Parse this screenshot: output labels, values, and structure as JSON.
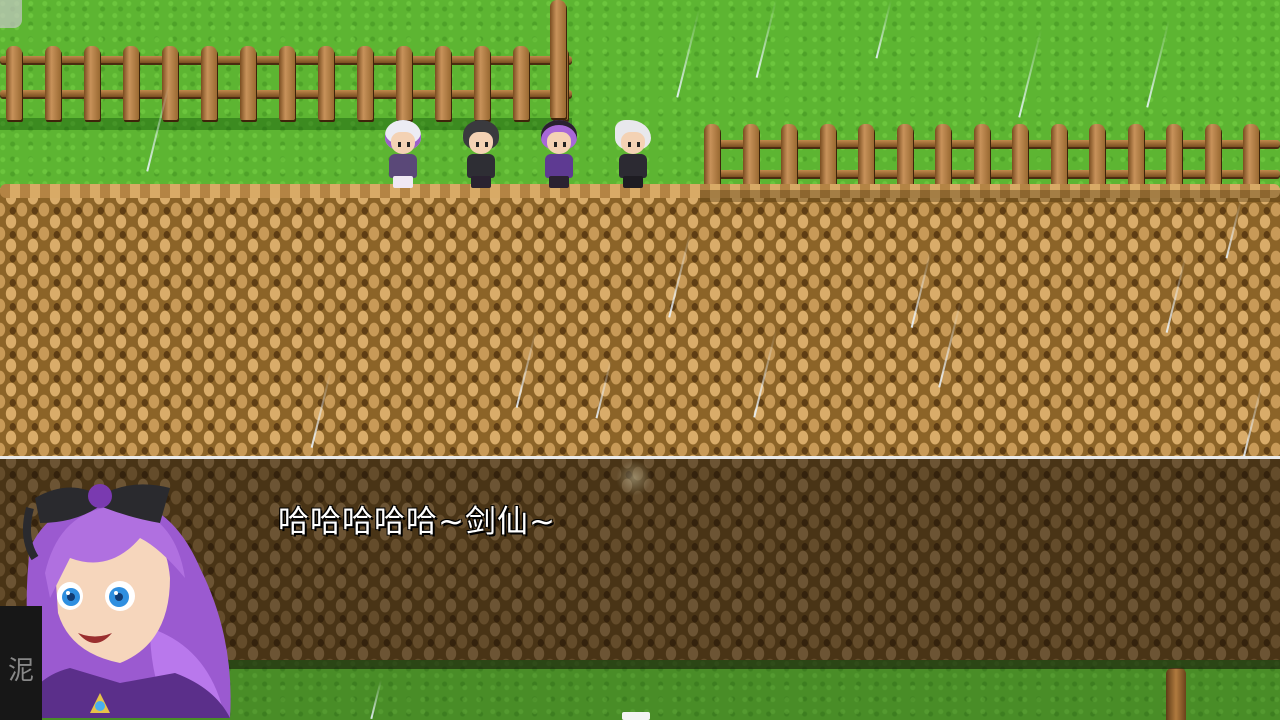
{
  "dialogue": {
    "text": "哈哈哈哈哈~剑仙~",
    "speaker_portrait": "purple-haired-girl-with-black-bow"
  },
  "watermark": {
    "glyph": "泥"
  },
  "scene": {
    "weather": "rain",
    "terrain": [
      "grass-plateau",
      "rocky-cliff",
      "wooden-fence"
    ],
    "party": [
      "girl-white-bonnet",
      "dark-haired-boy",
      "purple-haired-girl",
      "white-haired-swordsman"
    ]
  },
  "colors": {
    "grass": "#5db532",
    "cliff": "#8c6428",
    "message_window": "#120c08",
    "text": "#ffffff",
    "portrait_hair": "#b070e0"
  }
}
